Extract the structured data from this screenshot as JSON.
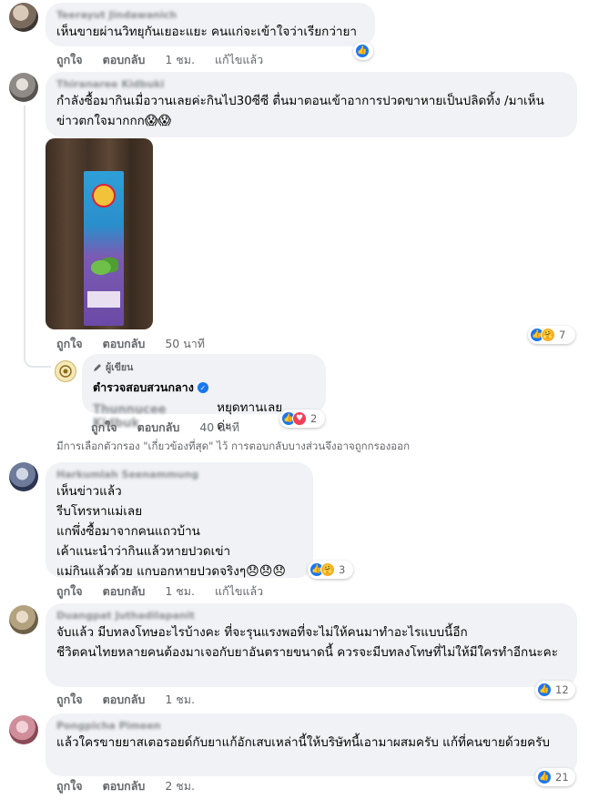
{
  "comments": [
    {
      "author": "Teerayut Jindawanich",
      "text": "เห็นขายผ่านวิทยุกันเยอะแยะ คนแก่จะเข้าใจว่าเรียกว่ายา",
      "like_label": "ถูกใจ",
      "reply_label": "ตอบกลับ",
      "time": "1 ชม.",
      "edited": "แก้ไขแล้ว"
    },
    {
      "author": "Thiranaree Kidbuki",
      "text": "กำลังซื้อมากินเมื่อวานเลยค่ะกินไป30ซีซี ตื่นมาตอนเข้าอาการปวดขาหายเป็นปลิดทิ้ง /มาเห็นข่าวตกใจมากกก",
      "emojis": "😱😱",
      "like_label": "ถูกใจ",
      "reply_label": "ตอบกลับ",
      "time": "50 นาที",
      "reaction_count": "7"
    },
    {
      "author_tag": "ผู้เขียน",
      "author": "ตำรวจสอบสวนกลาง",
      "mention": "Thunnucee Kidbuk",
      "text": "หยุดทานเลยค่ะ",
      "emoji": "❤️",
      "like_label": "ถูกใจ",
      "reply_label": "ตอบกลับ",
      "time": "40 นาที",
      "reaction_count": "2"
    },
    {
      "author": "Harkumlah Seenammung",
      "text": "เห็นข่าวแล้ว\nรีบโทรหาแม่เลย\nแกพึ่งซื้อมาจากคนแถวบ้าน\nเค้าแนะนำว่ากินแล้วหายปวดเข่า\nแม่กินแล้วด้วย แกบอกหายปวดจริงๆ",
      "emojis": "😞😞😞",
      "like_label": "ถูกใจ",
      "reply_label": "ตอบกลับ",
      "time": "1 ชม.",
      "edited": "แก้ไขแล้ว",
      "reaction_count": "3"
    },
    {
      "author": "Duangpat Juthadilapanit",
      "text": "จับแล้ว มีบทลงโทษอะไรบ้างคะ ที่จะรุนแรงพอที่จะไม่ให้คนมาทำอะไรแบบนี้อีก\nชีวิตคนไทยหลายคนต้องมาเจอกับยาอันตรายขนาดนี้ ควรจะมีบทลงโทษที่ไม่ให้มีใครทำอีกนะคะ",
      "like_label": "ถูกใจ",
      "reply_label": "ตอบกลับ",
      "time": "1 ชม.",
      "reaction_count": "12"
    },
    {
      "author": "Pongpicha Pimeen",
      "text": "แล้วใครขายยาสเตอรอยด์กับยาแก้อักเสบเหล่านี้ให้บริษัทนี้เอามาผสมครับ แก้ที่คนขายด้วยครับ",
      "like_label": "ถูกใจ",
      "reply_label": "ตอบกลับ",
      "time": "2 ชม.",
      "reaction_count": "21"
    }
  ],
  "filter_note": "มีการเลือกตัวกรอง \"เกี่ยวข้องที่สุด\" ไว้ การตอบกลับบางส่วนจึงอาจถูกกรองออก",
  "colors": {
    "bubble": "#f0f2f5",
    "meta": "#65676b",
    "like_blue": "#1877f2",
    "heart_red": "#f33e58"
  }
}
